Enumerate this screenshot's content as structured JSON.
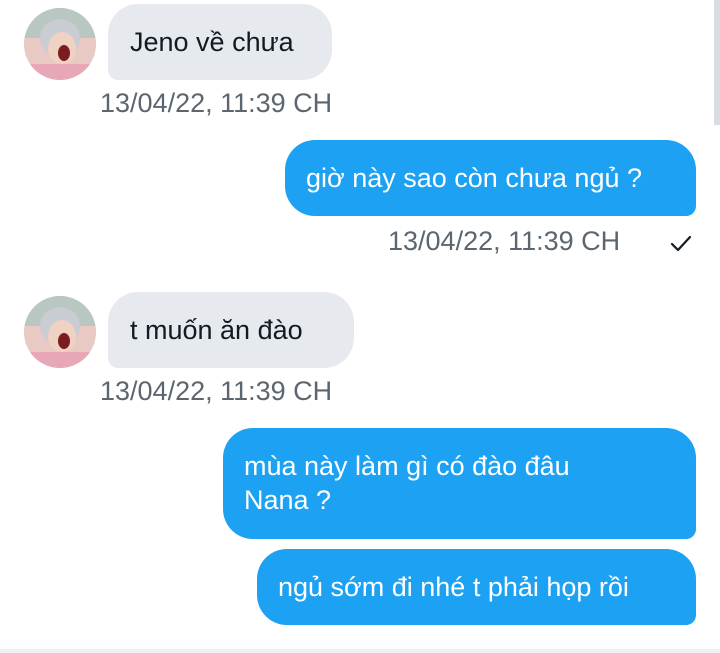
{
  "conversation": {
    "messages": [
      {
        "direction": "incoming",
        "text": "Jeno về chưa",
        "timestamp": "13/04/22, 11:39 CH"
      },
      {
        "direction": "outgoing",
        "text": "giờ này sao còn chưa ngủ ?",
        "timestamp": "13/04/22, 11:39 CH",
        "status_icon": "read-check-icon"
      },
      {
        "direction": "incoming",
        "text": "t muốn ăn đào",
        "timestamp": "13/04/22, 11:39 CH"
      },
      {
        "direction": "outgoing",
        "text_line1": "mùa này làm gì có đào đâu",
        "text_line2": "Nana ?"
      },
      {
        "direction": "outgoing",
        "text": "ngủ sớm đi nhé t phải họp rồi"
      }
    ]
  },
  "colors": {
    "outgoing_bubble": "#1da1f2",
    "incoming_bubble": "#e6e9ee",
    "timestamp_text": "#5b6670"
  },
  "icons": {
    "avatar": "avatar-icon",
    "check": "check-icon"
  }
}
